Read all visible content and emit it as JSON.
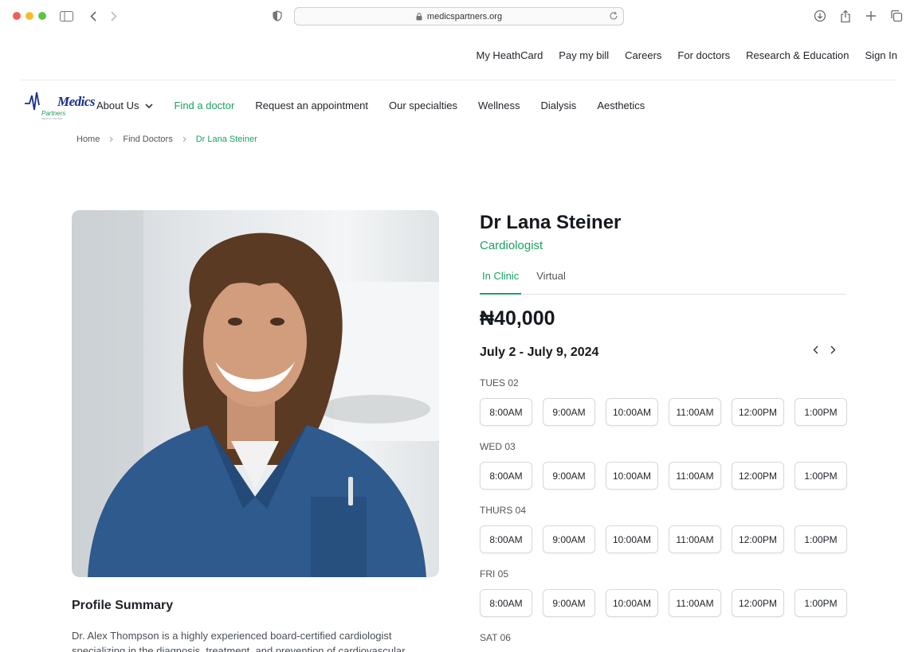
{
  "browser": {
    "url": "medicspartners.org"
  },
  "utility_nav": [
    "My HeathCard",
    "Pay my bill",
    "Careers",
    "For doctors",
    "Research & Education",
    "Sign In"
  ],
  "logo": {
    "name": "Medics",
    "sub": "Partners",
    "tiny": "MEDICAL CENTER"
  },
  "main_nav": {
    "about": "About Us",
    "find_doctor": "Find a doctor",
    "request": "Request an appointment",
    "specialties": "Our specialties",
    "wellness": "Wellness",
    "dialysis": "Dialysis",
    "aesthetics": "Aesthetics"
  },
  "breadcrumb": {
    "home": "Home",
    "find": "Find Doctors",
    "current": "Dr Lana Steiner"
  },
  "doctor": {
    "name": "Dr Lana Steiner",
    "specialty": "Cardiologist"
  },
  "tabs": {
    "clinic": "In Clinic",
    "virtual": "Virtual"
  },
  "price": "₦40,000",
  "date_range": "July 2 - July 9, 2024",
  "days": [
    {
      "label": "TUES 02",
      "slots": [
        "8:00AM",
        "9:00AM",
        "10:00AM",
        "11:00AM",
        "12:00PM",
        "1:00PM"
      ]
    },
    {
      "label": "WED 03",
      "slots": [
        "8:00AM",
        "9:00AM",
        "10:00AM",
        "11:00AM",
        "12:00PM",
        "1:00PM"
      ]
    },
    {
      "label": "THURS 04",
      "slots": [
        "8:00AM",
        "9:00AM",
        "10:00AM",
        "11:00AM",
        "12:00PM",
        "1:00PM"
      ]
    },
    {
      "label": "FRI 05",
      "slots": [
        "8:00AM",
        "9:00AM",
        "10:00AM",
        "11:00AM",
        "12:00PM",
        "1:00PM"
      ]
    },
    {
      "label": "SAT 06",
      "slots": []
    }
  ],
  "profile": {
    "title": "Profile Summary",
    "text": "Dr. Alex Thompson is a highly experienced board-certified cardiologist specializing in the diagnosis, treatment, and prevention of cardiovascular"
  },
  "colors": {
    "accent": "#1aa260",
    "brand": "#1a2e8a"
  }
}
